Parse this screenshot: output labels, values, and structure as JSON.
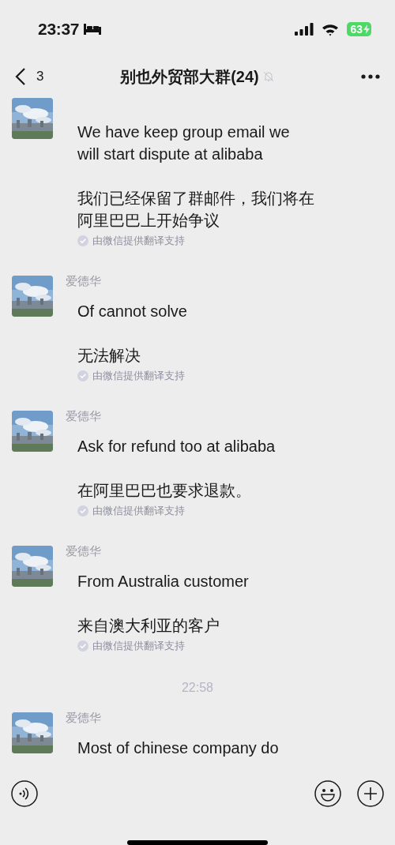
{
  "status_bar": {
    "time": "23:37",
    "battery": "63"
  },
  "nav": {
    "back_count": "3",
    "title": "别也外贸部大群(24)"
  },
  "messages": [
    {
      "kind": "message",
      "text": "We have keep group email we will start dispute at alibaba",
      "translation": "我们已经保留了群邮件，我们将在阿里巴巴上开始争议",
      "note": "由微信提供翻译支持"
    },
    {
      "kind": "message",
      "name": "爱德华",
      "text": "Of cannot solve",
      "translation": "无法解决",
      "note": "由微信提供翻译支持"
    },
    {
      "kind": "message",
      "name": "爱德华",
      "text": "Ask for refund too at alibaba",
      "translation": "在阿里巴巴也要求退款。",
      "note": "由微信提供翻译支持"
    },
    {
      "kind": "message",
      "name": "爱德华",
      "text": "From Australia customer",
      "translation": "来自澳大利亚的客户",
      "note": "由微信提供翻译支持"
    },
    {
      "kind": "time",
      "text": "22:58"
    },
    {
      "kind": "message",
      "name": "爱德华",
      "text": "Most of chinese company do"
    }
  ]
}
